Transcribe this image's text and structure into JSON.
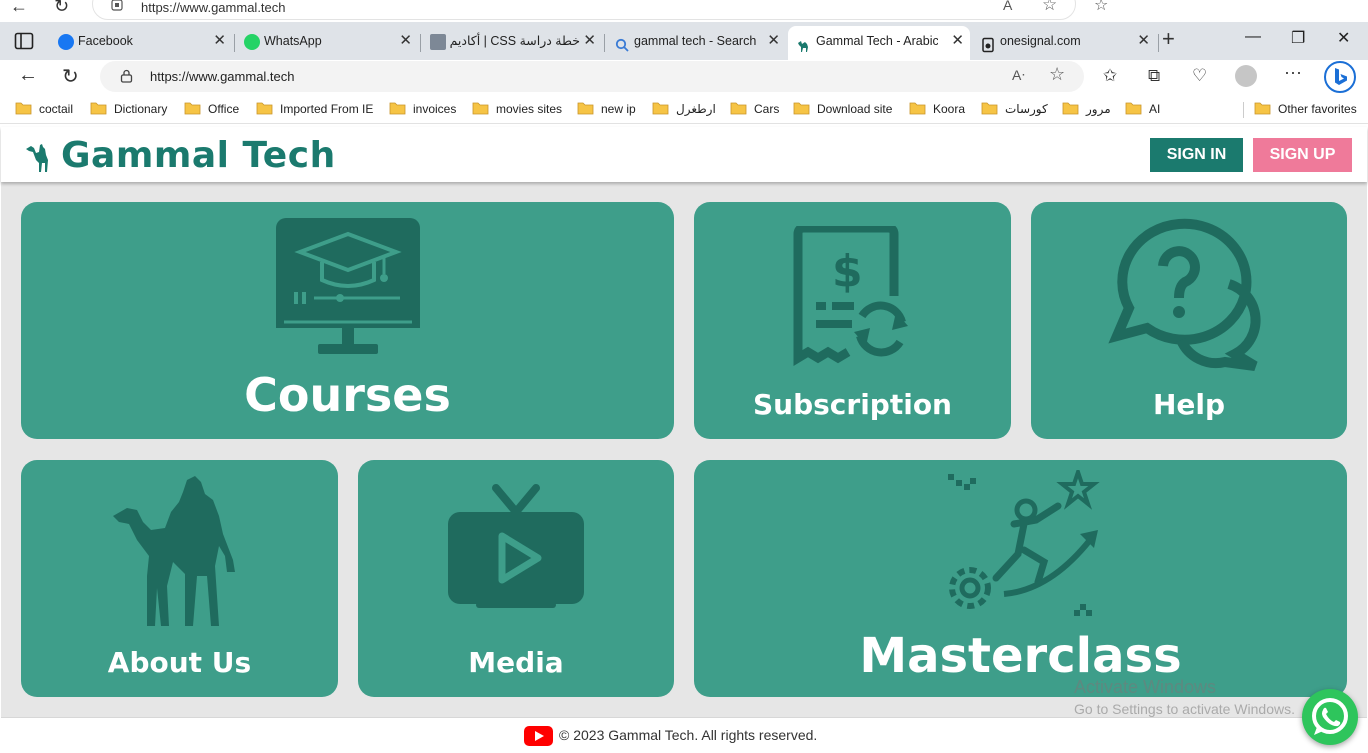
{
  "ghost_bar": {
    "url": "https://www.gammal.tech"
  },
  "tabs": [
    {
      "label": "Facebook",
      "icon": "facebook-icon",
      "active": false
    },
    {
      "label": "WhatsApp",
      "icon": "whatsapp-icon",
      "active": false
    },
    {
      "label": "خطة دراسة CSS | أكاديم",
      "icon": "e-icon",
      "active": false
    },
    {
      "label": "gammal tech - Search",
      "icon": "search-icon",
      "active": false
    },
    {
      "label": "Gammal Tech - Arabic",
      "icon": "camel-icon",
      "active": true
    },
    {
      "label": "onesignal.com",
      "icon": "page-icon",
      "active": false
    }
  ],
  "address_bar": {
    "url": "https://www.gammal.tech"
  },
  "favorites": [
    {
      "label": "coctail"
    },
    {
      "label": "Dictionary"
    },
    {
      "label": "Office"
    },
    {
      "label": "Imported From IE"
    },
    {
      "label": "invoices"
    },
    {
      "label": "movies sites"
    },
    {
      "label": "new ip"
    },
    {
      "label": "ارطغرل"
    },
    {
      "label": "Cars"
    },
    {
      "label": "Download site"
    },
    {
      "label": "Koora"
    },
    {
      "label": "كورسات"
    },
    {
      "label": "مرور"
    },
    {
      "label": "AI"
    }
  ],
  "other_favorites": "Other favorites",
  "site": {
    "logo_text": "Gammal Tech",
    "sign_in": "SIGN IN",
    "sign_up": "SIGN UP",
    "cards": {
      "courses": "Courses",
      "subscription": "Subscription",
      "help": "Help",
      "about": "About Us",
      "media": "Media",
      "masterclass": "Masterclass"
    },
    "footer": "© 2023 Gammal Tech. All rights reserved."
  },
  "watermark": {
    "title": "Activate Windows",
    "subtitle": "Go to Settings to activate Windows."
  },
  "colors": {
    "brand_teal": "#1b7a6e",
    "card_teal": "#3e9e8a",
    "icon_dark_teal": "#1f6b5e",
    "signup_pink": "#ef7a9a",
    "page_bg": "#e6e6e6"
  }
}
